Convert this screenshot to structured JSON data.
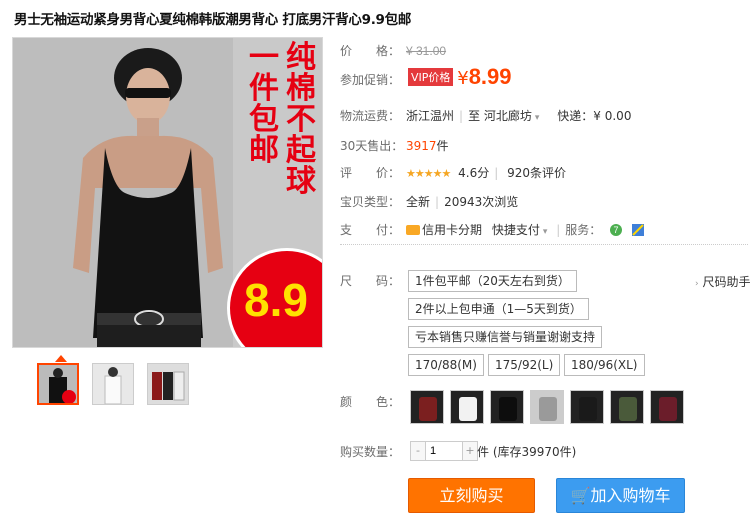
{
  "title": "男士无袖运动紧身男背心夏纯棉韩版潮男背心 打底男汗背心9.9包邮",
  "image": {
    "promo_col1": "一件包邮",
    "promo_col2": "纯棉不起球",
    "badge_price": "8.9",
    "thumb_badge": "8.9"
  },
  "price": {
    "label": "价　　格：",
    "original": "¥ 31.00",
    "promo_label": "参加促销：",
    "vip_tag": "VIP价格",
    "yen": "¥",
    "value": "8.99"
  },
  "shipping": {
    "label": "物流运费：",
    "from": "浙江温州",
    "sep": "至",
    "to": "河北廊坊",
    "express": "快递：¥ 0.00"
  },
  "sales": {
    "label": "30天售出：",
    "count": "3917",
    "unit": "件"
  },
  "rating": {
    "label": "评　　价：",
    "stars": "★★★★★",
    "score": "4.6分",
    "reviews": "920条评价"
  },
  "type": {
    "label": "宝贝类型：",
    "value": "全新",
    "views": "20943次浏览"
  },
  "payment": {
    "label": "支　　付：",
    "card": "信用卡分期",
    "quick": "快捷支付",
    "service_label": "服务："
  },
  "size": {
    "label": "尺　　码：",
    "options": [
      "1件包平邮（20天左右到货）",
      "2件以上包申通（1—5天到货）",
      "亏本销售只赚信誉与销量谢谢支持",
      "170/88(M)",
      "175/92(L)",
      "180/96(XL)"
    ],
    "helper": "尺码助手"
  },
  "color": {
    "label": "颜　　色："
  },
  "quantity": {
    "label": "购买数量：",
    "minus": "-",
    "value": "1",
    "plus": "+",
    "unit": "件 (库存39970件)"
  },
  "actions": {
    "buy": "立刻购买",
    "cart": "加入购物车"
  }
}
